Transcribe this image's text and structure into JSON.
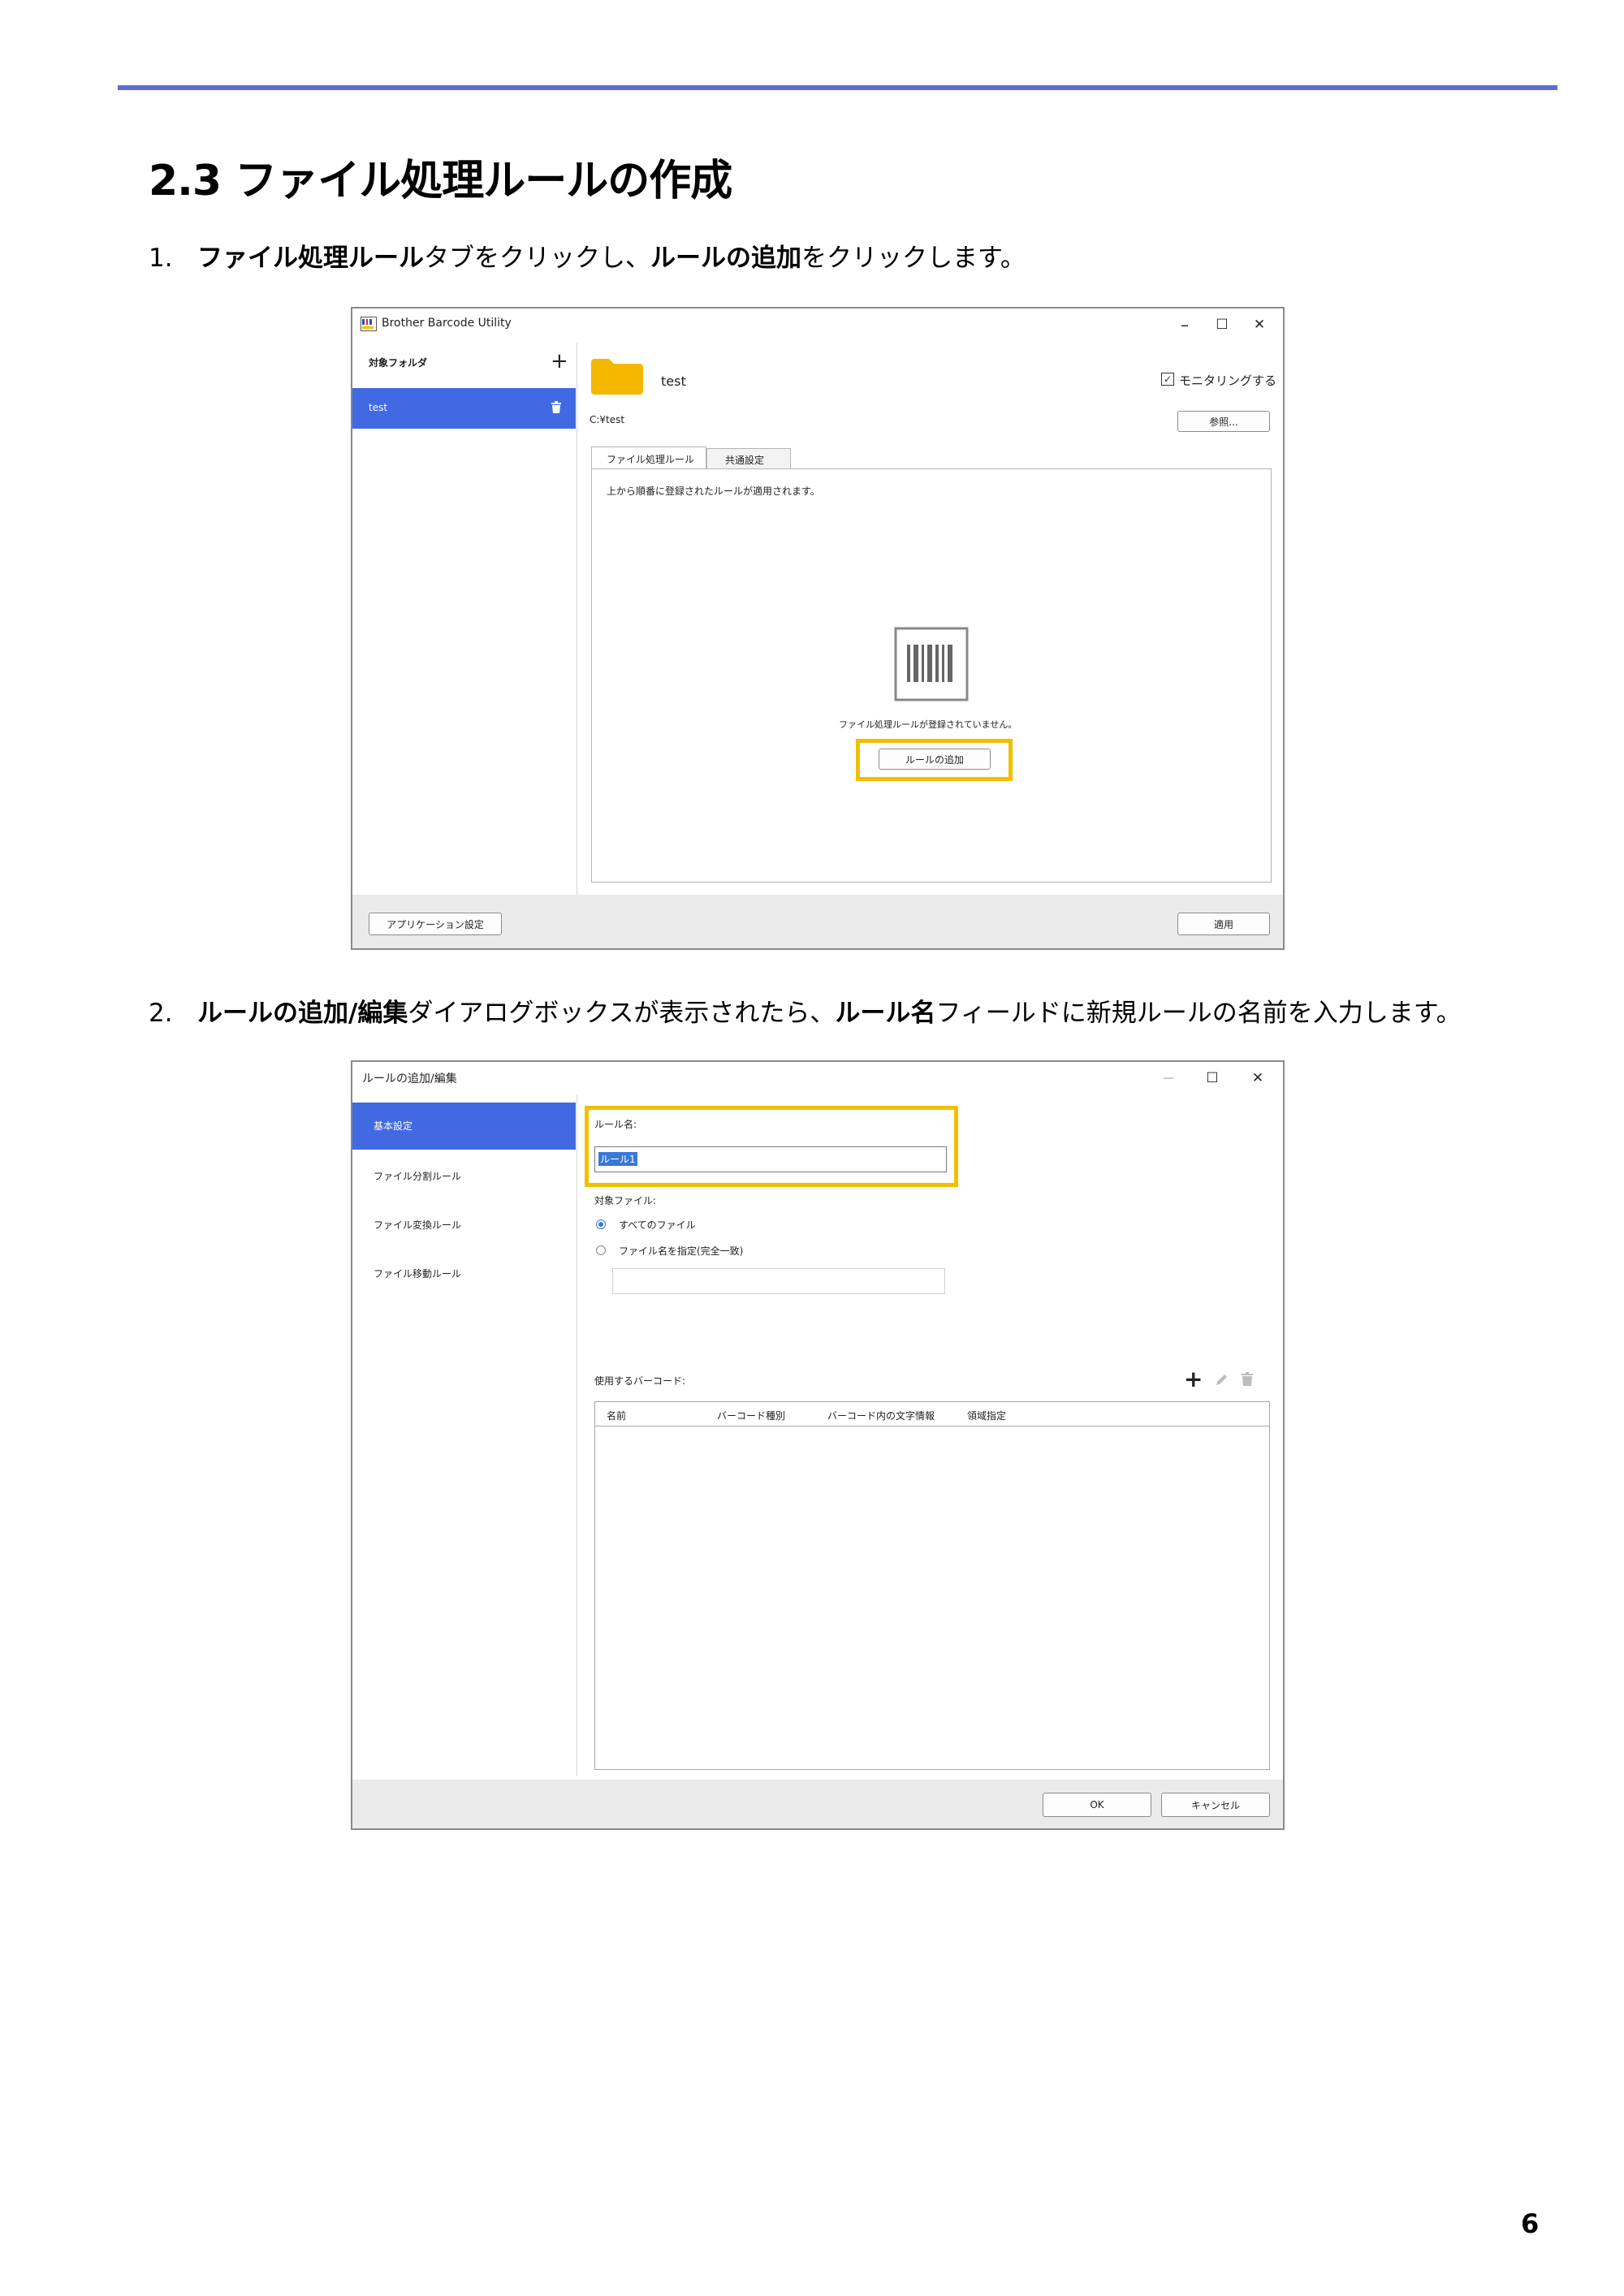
{
  "section": {
    "title": "2.3 ファイル処理ルールの作成"
  },
  "steps": [
    {
      "number": "1.",
      "parts": [
        {
          "text": "ファイル処理ルール",
          "bold": true
        },
        {
          "text": "タブをクリックし、",
          "bold": false
        },
        {
          "text": "ルールの追加",
          "bold": true
        },
        {
          "text": "をクリックします。",
          "bold": false
        }
      ]
    },
    {
      "number": "2.",
      "parts": [
        {
          "text": "ルールの追加/編集",
          "bold": true
        },
        {
          "text": "ダイアログボックスが表示されたら、",
          "bold": false
        },
        {
          "text": "ルール名",
          "bold": true
        },
        {
          "text": "フィールドに新規ルールの名前を入力します。",
          "bold": false
        }
      ]
    }
  ],
  "window1": {
    "title": "Brother Barcode Utility",
    "controls": {
      "minimize": "–",
      "maximize": "☐",
      "close": "✕"
    },
    "sidebar": {
      "header": "対象フォルダ",
      "add": "+",
      "items": [
        {
          "label": "test",
          "selected": true
        }
      ]
    },
    "folder": {
      "name": "test",
      "path": "C:¥test"
    },
    "monitoring": {
      "label": "モニタリングする",
      "checked": true
    },
    "browse_button": "参照...",
    "tabs": [
      {
        "label": "ファイル処理ルール",
        "active": true
      },
      {
        "label": "共通設定",
        "active": false
      }
    ],
    "info_text": "上から順番に登録されたルールが適用されます。",
    "empty_message": "ファイル処理ルールが登録されていません。",
    "add_rule_button": "ルールの追加",
    "app_settings_button": "アプリケーション設定",
    "apply_button": "適用"
  },
  "window2": {
    "title": "ルールの追加/編集",
    "controls": {
      "minimize": "—",
      "maximize": "☐",
      "close": "✕"
    },
    "nav": [
      {
        "label": "基本設定",
        "selected": true
      },
      {
        "label": "ファイル分割ルール",
        "selected": false
      },
      {
        "label": "ファイル変換ルール",
        "selected": false
      },
      {
        "label": "ファイル移動ルール",
        "selected": false
      }
    ],
    "rule_name_label": "ルール名:",
    "rule_name_value": "ルール1",
    "target_file_label": "対象ファイル:",
    "options": [
      {
        "label": "すべてのファイル",
        "checked": true
      },
      {
        "label": "ファイル名を指定(完全一致)",
        "checked": false
      }
    ],
    "filename_value": "",
    "barcode_label": "使用するバーコード:",
    "toolbar_icons": [
      "plus-icon",
      "pencil-icon",
      "trash-icon"
    ],
    "columns": [
      "名前",
      "バーコード種別",
      "バーコード内の文字情報",
      "領域指定"
    ],
    "rows": [],
    "ok_button": "OK",
    "cancel_button": "キャンセル"
  },
  "page_number": "6"
}
